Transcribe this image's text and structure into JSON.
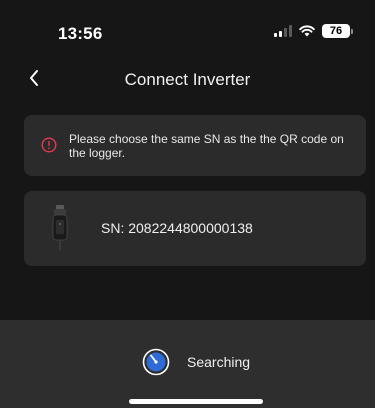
{
  "status_bar": {
    "time": "13:56",
    "battery": "76",
    "signal_bars_active": 2,
    "signal_bars_total": 4
  },
  "nav": {
    "title": "Connect Inverter",
    "back_icon": "chevron-left-icon"
  },
  "warning": {
    "icon": "alert-circle-icon",
    "text": "Please choose the same SN as the the QR code on the logger.",
    "icon_color": "#e4394f"
  },
  "device": {
    "icon": "logger-icon",
    "sn": "SN: 2082244800000138"
  },
  "footer": {
    "icon": "searching-spinner-icon",
    "label": "Searching",
    "spinner_color": "#2e6bd6"
  },
  "colors": {
    "background": "#161616",
    "card": "#2b2b2b",
    "panel": "#2e2e2e"
  }
}
